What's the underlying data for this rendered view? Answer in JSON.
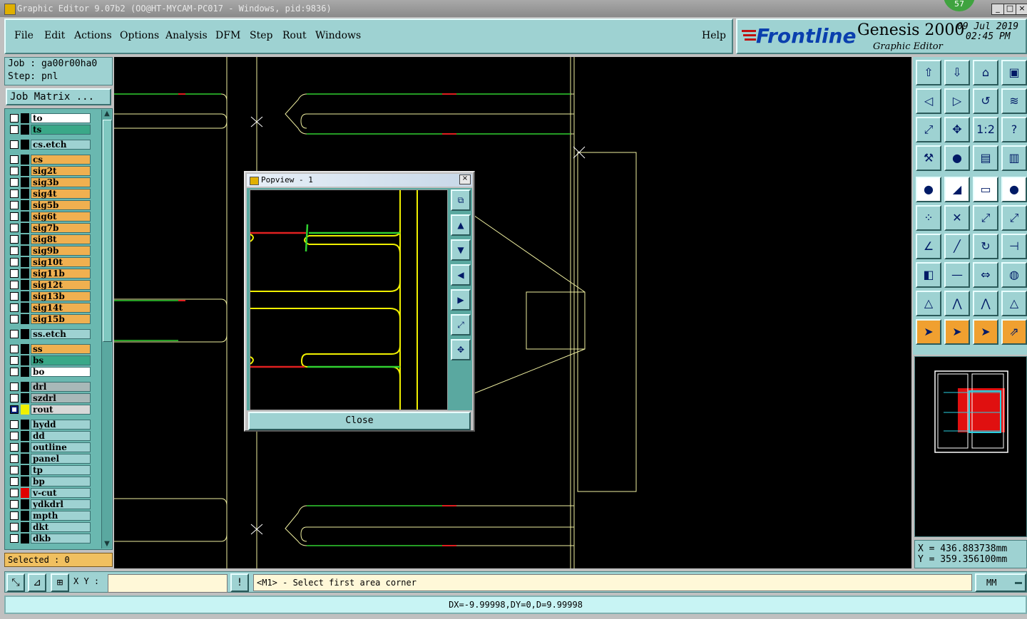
{
  "window": {
    "title": "Graphic Editor 9.07b2 (OO@HT-MYCAM-PC017 - Windows, pid:9836)",
    "badge": "57",
    "min": "_",
    "max": "□",
    "close": "×"
  },
  "menu": {
    "items": [
      "File",
      "Edit",
      "Actions",
      "Options",
      "Analysis",
      "DFM",
      "Step",
      "Rout",
      "Windows"
    ],
    "help": "Help"
  },
  "brand": {
    "logo": "Frontline",
    "product": "Genesis 2000",
    "subtitle": "Graphic Editor",
    "date": "09 Jul 2019",
    "time": "02:45 PM"
  },
  "job": {
    "job_line": "Job : ga00r00ha0",
    "step_line": "Step: pnl",
    "matrix_button": "Job Matrix ..."
  },
  "layers": [
    {
      "name": "to",
      "color": "#ffffff",
      "cbox": "#000000",
      "checked": false
    },
    {
      "name": "ts",
      "color": "#3aa888",
      "cbox": "#000000",
      "checked": false
    },
    {
      "name": "cs.etch",
      "color": "#9ed2d2",
      "cbox": "#000000",
      "checked": false
    },
    {
      "name": "cs",
      "color": "#f0b050",
      "cbox": "#000000",
      "checked": false
    },
    {
      "name": "sig2t",
      "color": "#f0b050",
      "cbox": "#000000",
      "checked": false
    },
    {
      "name": "sig3b",
      "color": "#f0b050",
      "cbox": "#000000",
      "checked": false
    },
    {
      "name": "sig4t",
      "color": "#f0b050",
      "cbox": "#000000",
      "checked": false
    },
    {
      "name": "sig5b",
      "color": "#f0b050",
      "cbox": "#000000",
      "checked": false
    },
    {
      "name": "sig6t",
      "color": "#f0b050",
      "cbox": "#000000",
      "checked": false
    },
    {
      "name": "sig7b",
      "color": "#f0b050",
      "cbox": "#000000",
      "checked": false
    },
    {
      "name": "sig8t",
      "color": "#f0b050",
      "cbox": "#000000",
      "checked": false
    },
    {
      "name": "sig9b",
      "color": "#f0b050",
      "cbox": "#000000",
      "checked": false
    },
    {
      "name": "sig10t",
      "color": "#f0b050",
      "cbox": "#000000",
      "checked": false
    },
    {
      "name": "sig11b",
      "color": "#f0b050",
      "cbox": "#000000",
      "checked": false
    },
    {
      "name": "sig12t",
      "color": "#f0b050",
      "cbox": "#000000",
      "checked": false
    },
    {
      "name": "sig13b",
      "color": "#f0b050",
      "cbox": "#000000",
      "checked": false
    },
    {
      "name": "sig14t",
      "color": "#f0b050",
      "cbox": "#000000",
      "checked": false
    },
    {
      "name": "sig15b",
      "color": "#f0b050",
      "cbox": "#000000",
      "checked": false
    },
    {
      "name": "ss.etch",
      "color": "#9ed2d2",
      "cbox": "#000000",
      "checked": false
    },
    {
      "name": "ss",
      "color": "#f0b050",
      "cbox": "#000000",
      "checked": false
    },
    {
      "name": "bs",
      "color": "#3aa888",
      "cbox": "#000000",
      "checked": false
    },
    {
      "name": "bo",
      "color": "#ffffff",
      "cbox": "#000000",
      "checked": false
    },
    {
      "name": "drl",
      "color": "#a8b8b8",
      "cbox": "#000000",
      "checked": false
    },
    {
      "name": "szdrl",
      "color": "#a8b8b8",
      "cbox": "#000000",
      "checked": false
    },
    {
      "name": "rout",
      "color": "#d8d8d8",
      "cbox": "#f0f000",
      "checked": true
    },
    {
      "name": "hydd",
      "color": "#9ed2d2",
      "cbox": "#000000",
      "checked": false
    },
    {
      "name": "dd",
      "color": "#9ed2d2",
      "cbox": "#000000",
      "checked": false
    },
    {
      "name": "outline",
      "color": "#9ed2d2",
      "cbox": "#000000",
      "checked": false
    },
    {
      "name": "panel",
      "color": "#9ed2d2",
      "cbox": "#000000",
      "checked": false
    },
    {
      "name": "tp",
      "color": "#9ed2d2",
      "cbox": "#000000",
      "checked": false
    },
    {
      "name": "bp",
      "color": "#9ed2d2",
      "cbox": "#000000",
      "checked": false
    },
    {
      "name": "v-cut",
      "color": "#9ed2d2",
      "cbox": "#e00000",
      "checked": false
    },
    {
      "name": "ydkdrl",
      "color": "#9ed2d2",
      "cbox": "#000000",
      "checked": false
    },
    {
      "name": "mpth",
      "color": "#9ed2d2",
      "cbox": "#000000",
      "checked": false
    },
    {
      "name": "dkt",
      "color": "#9ed2d2",
      "cbox": "#000000",
      "checked": false
    },
    {
      "name": "dkb",
      "color": "#9ed2d2",
      "cbox": "#000000",
      "checked": false
    }
  ],
  "selected": "Selected : 0",
  "coords": {
    "x": "X = 436.883738mm",
    "y": "Y = 359.356100mm"
  },
  "command": {
    "xy_label": "X Y :",
    "xy_value": "",
    "prompt": "<M1> - Select first area corner",
    "units": "MM"
  },
  "status": "DX=-9.99998,DY=0,D=9.99998",
  "popview": {
    "title": "Popview - 1",
    "close_label": "Close",
    "close_x": "×"
  },
  "toolbar_icons": [
    "open-step-icon",
    "save-icon",
    "home-icon",
    "panel-icon",
    "prev-icon",
    "next-icon",
    "undo-icon",
    "snap-icon",
    "zoom-fit-icon",
    "zoom-home-icon",
    "scale-icon",
    "help-icon",
    "tools-icon",
    "probe-icon",
    "layer-filter-icon",
    "layer-filter-alt-icon",
    "add-pad-icon",
    "add-line-icon",
    "ruler-icon",
    "add-circle-icon",
    "connect-icon",
    "cross-icon",
    "move-pad-icon",
    "move-line-icon",
    "angle-icon",
    "slash-icon",
    "arc-icon",
    "mirror-icon",
    "select-pad-icon",
    "minus-icon",
    "dimension-icon",
    "shapes-icon",
    "triangle-a-icon",
    "triangle-b-icon",
    "triangle-c-icon",
    "triangle-d-icon",
    "pointer-icon",
    "pointer-select-icon",
    "pointer-touch-icon",
    "net-pointer-icon"
  ]
}
